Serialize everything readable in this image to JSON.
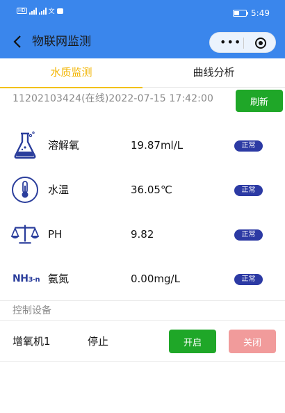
{
  "status_bar": {
    "time": "5:49",
    "lang_glyph": "文"
  },
  "nav": {
    "title": "物联网监测"
  },
  "tabs": [
    {
      "label": "水质监测"
    },
    {
      "label": "曲线分析"
    }
  ],
  "device": {
    "info": "11202103424(在线)2022-07-15 17:42:00",
    "refresh_label": "刷新"
  },
  "sensors": [
    {
      "name": "溶解氧",
      "value": "19.87ml/L",
      "status": "正常",
      "icon": "flask-icon"
    },
    {
      "name": "水温",
      "value": "36.05℃",
      "status": "正常",
      "icon": "thermometer-icon"
    },
    {
      "name": "PH",
      "value": "9.82",
      "status": "正常",
      "icon": "scale-icon"
    },
    {
      "name": "氨氮",
      "value": "0.00mg/L",
      "status": "正常",
      "icon": "nh3-icon",
      "icon_text": "NH",
      "icon_sub": "3-n"
    }
  ],
  "control": {
    "section_label": "控制设备",
    "devices": [
      {
        "name": "增氧机1",
        "state": "停止",
        "on_label": "开启",
        "off_label": "关闭"
      }
    ]
  },
  "colors": {
    "primary": "#3a86ec",
    "active_tab": "#f2b400",
    "green": "#1fa728",
    "badge": "#2c3aa4",
    "disabled_red": "#f19b9b"
  }
}
